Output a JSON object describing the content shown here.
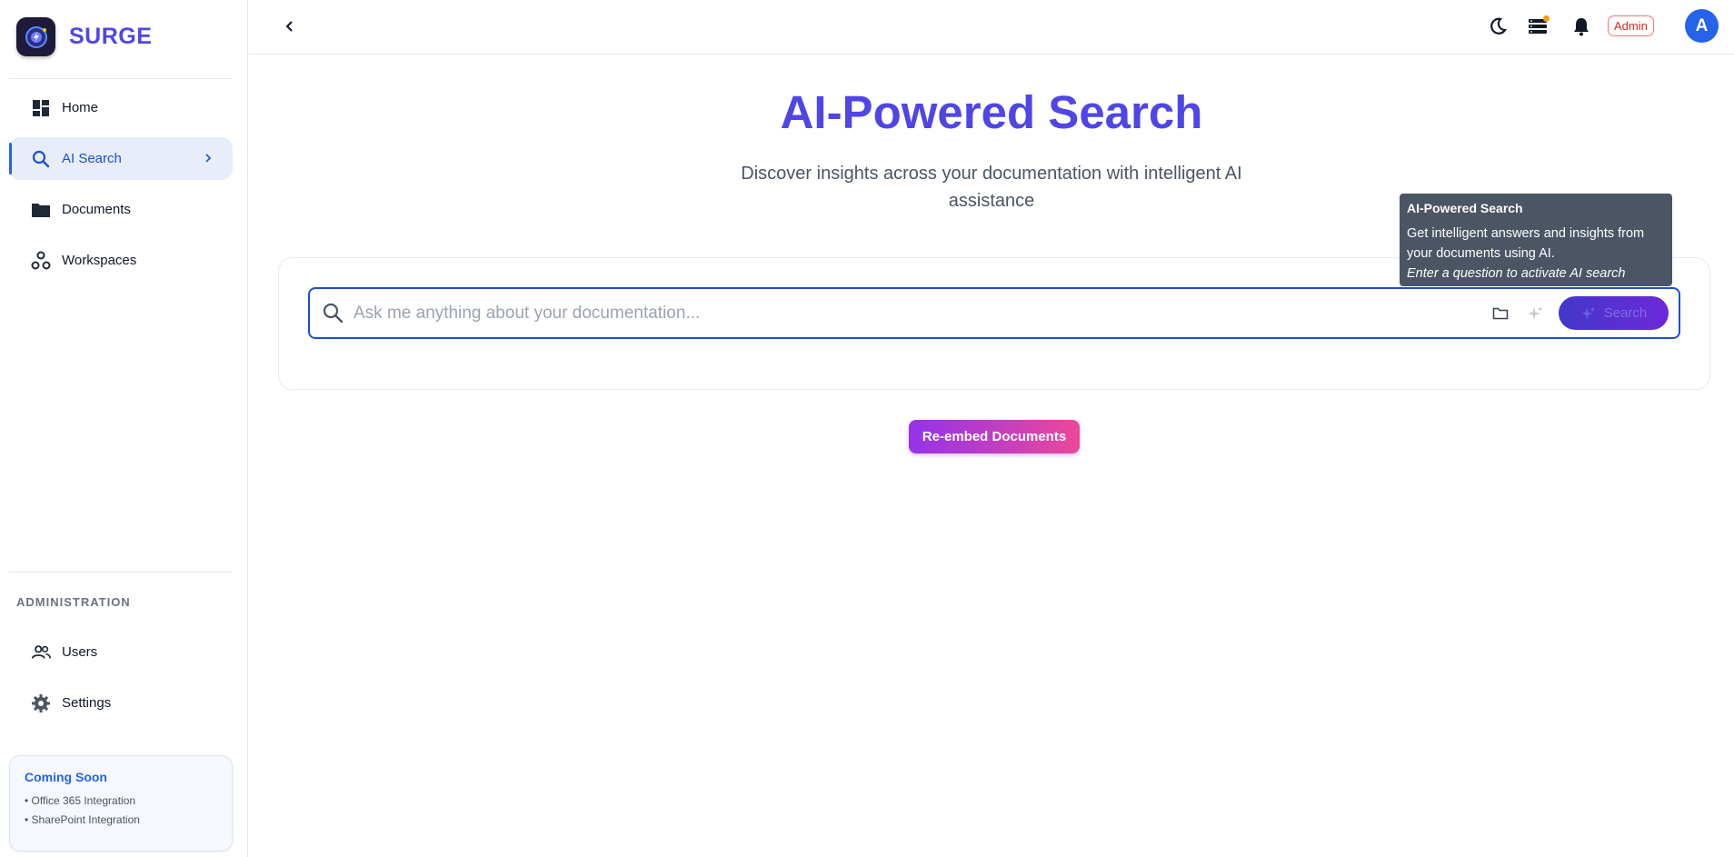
{
  "app": {
    "name": "SURGE"
  },
  "sidebar": {
    "items": [
      {
        "label": "Home",
        "icon": "dashboard-icon"
      },
      {
        "label": "AI Search",
        "icon": "search-icon",
        "active": true
      },
      {
        "label": "Documents",
        "icon": "folder-icon"
      },
      {
        "label": "Workspaces",
        "icon": "workspaces-icon"
      }
    ],
    "admin_title": "ADMINISTRATION",
    "admin_items": [
      {
        "label": "Users",
        "icon": "users-icon"
      },
      {
        "label": "Settings",
        "icon": "gear-icon"
      }
    ],
    "coming_soon": {
      "title": "Coming Soon",
      "items": [
        "• Office 365 Integration",
        "• SharePoint Integration"
      ]
    }
  },
  "topbar": {
    "role_badge": "Admin",
    "avatar_initial": "A",
    "icons": [
      "back-chevron-icon",
      "moon-icon",
      "stack-icon",
      "bell-icon"
    ]
  },
  "main": {
    "title": "AI-Powered Search",
    "subtitle": "Discover insights across your documentation with intelligent AI assistance",
    "search": {
      "placeholder": "Ask me anything about your documentation...",
      "value": "",
      "button_label": "Search"
    },
    "tooltip": {
      "title": "AI-Powered Search",
      "body": "Get intelligent answers and insights from your documents using AI.",
      "hint": "Enter a question to activate AI search"
    },
    "reembed_label": "Re-embed Documents"
  },
  "colors": {
    "brand": "#4f46e5",
    "active_nav": "#1d4ed8",
    "notification_dot": "#f59e0b",
    "admin_badge": "#dc2626",
    "reembed_gradient": [
      "#9333ea",
      "#ec4899"
    ]
  }
}
